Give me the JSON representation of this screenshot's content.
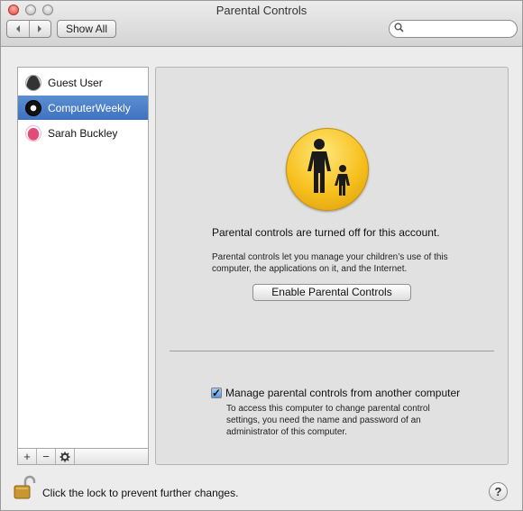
{
  "window": {
    "title": "Parental Controls"
  },
  "toolbar": {
    "back_icon": "chevron-left-icon",
    "forward_icon": "chevron-right-icon",
    "show_all_label": "Show All",
    "search_placeholder": "",
    "search_value": ""
  },
  "sidebar": {
    "users": [
      {
        "name": "Guest User",
        "icon": "guest-avatar-icon",
        "selected": false
      },
      {
        "name": "ComputerWeekly",
        "icon": "eight-ball-avatar-icon",
        "selected": true
      },
      {
        "name": "Sarah Buckley",
        "icon": "lips-avatar-icon",
        "selected": false
      }
    ],
    "add_label": "+",
    "remove_label": "−",
    "action_label": "✱"
  },
  "main": {
    "headline": "Parental controls are turned off for this account.",
    "description": "Parental controls let you manage your children’s use of this computer, the applications on it, and the Internet.",
    "enable_button_label": "Enable Parental Controls",
    "manage_checkbox_checked": true,
    "manage_label": "Manage parental controls from another computer",
    "manage_description": "To access this computer to change parental control settings, you need the name and password of an administrator of this computer."
  },
  "footer": {
    "lock_text": "Click the lock to prevent further changes.",
    "help_label": "?"
  },
  "colors": {
    "selection": "#3e72c1",
    "window_bg": "#ececec",
    "icon_yellow": "#f7c01e"
  }
}
